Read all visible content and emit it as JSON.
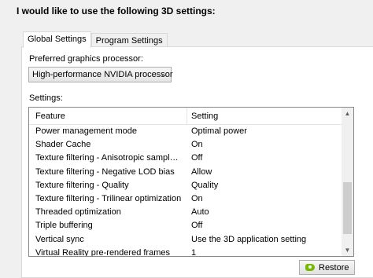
{
  "heading": "I would like to use the following 3D settings:",
  "tabs": [
    {
      "label": "Global Settings",
      "active": true
    },
    {
      "label": "Program Settings",
      "active": false
    }
  ],
  "preferred_gpu": {
    "label": "Preferred graphics processor:",
    "value": "High-performance NVIDIA processor"
  },
  "settings_label": "Settings:",
  "table": {
    "columns": [
      "Feature",
      "Setting"
    ],
    "rows": [
      {
        "feature": "Power management mode",
        "setting": "Optimal power"
      },
      {
        "feature": "Shader Cache",
        "setting": "On"
      },
      {
        "feature": "Texture filtering - Anisotropic sample opti...",
        "setting": "Off"
      },
      {
        "feature": "Texture filtering - Negative LOD bias",
        "setting": "Allow"
      },
      {
        "feature": "Texture filtering - Quality",
        "setting": "Quality"
      },
      {
        "feature": "Texture filtering - Trilinear optimization",
        "setting": "On"
      },
      {
        "feature": "Threaded optimization",
        "setting": "Auto"
      },
      {
        "feature": "Triple buffering",
        "setting": "Off"
      },
      {
        "feature": "Vertical sync",
        "setting": "Use the 3D application setting"
      },
      {
        "feature": "Virtual Reality pre-rendered frames",
        "setting": "1"
      }
    ]
  },
  "restore_button": {
    "label": "Restore",
    "icon": "nvidia-icon"
  },
  "icons": {
    "dropdown": "chevron-down-icon",
    "scroll_up": "scroll-up-arrow-icon",
    "scroll_down": "scroll-down-arrow-icon"
  },
  "colors": {
    "nvidia_green": "#76b900",
    "panel_bg": "#ffffff",
    "window_bg": "#f0f0f0"
  }
}
